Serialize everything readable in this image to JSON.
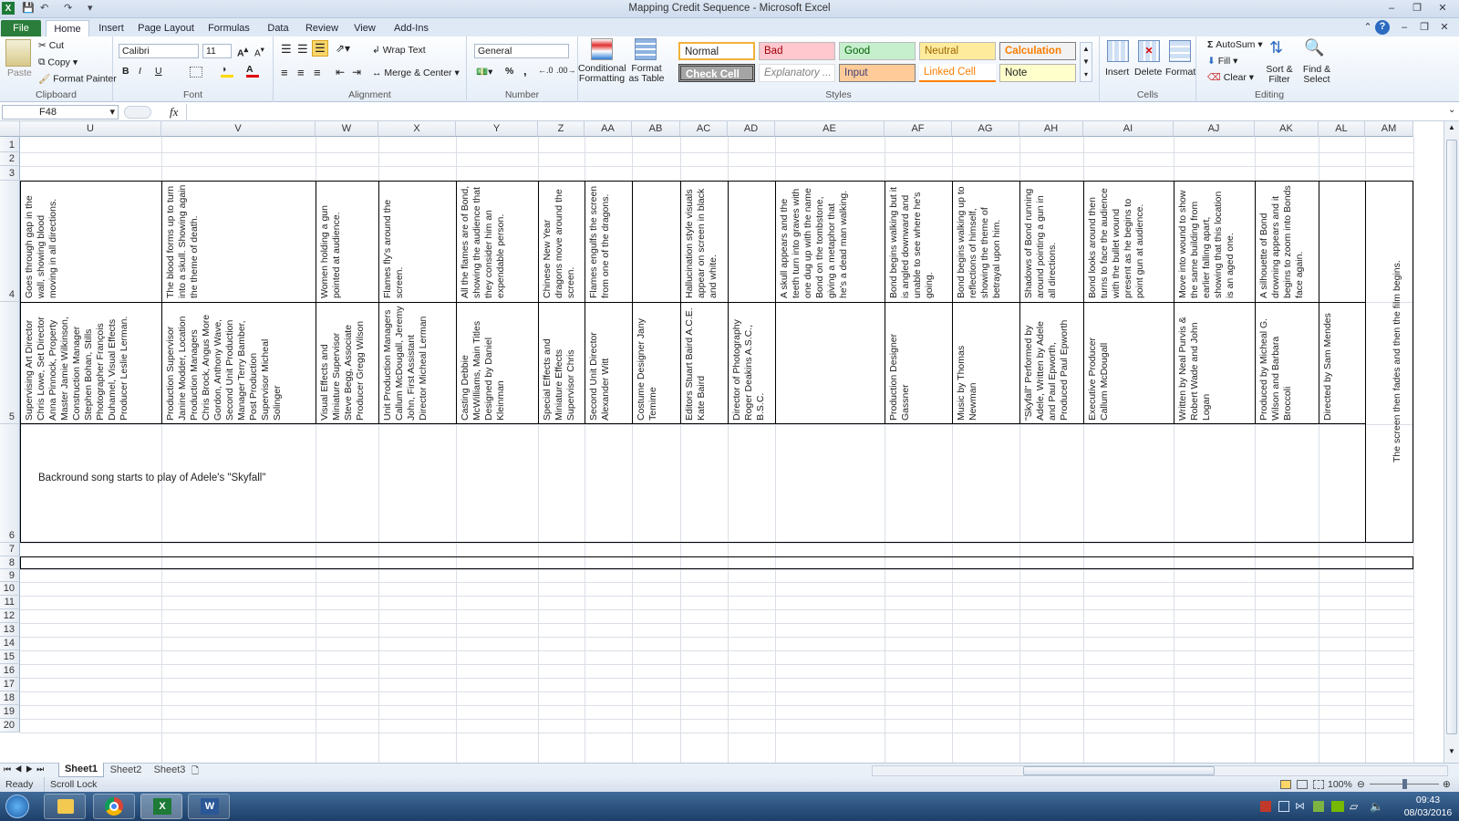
{
  "window": {
    "title": "Mapping Credit Sequence - Microsoft Excel"
  },
  "tabs": [
    "File",
    "Home",
    "Insert",
    "Page Layout",
    "Formulas",
    "Data",
    "Review",
    "View",
    "Add-Ins"
  ],
  "ribbon": {
    "clipboard": {
      "paste": "Paste",
      "cut": "Cut",
      "copy": "Copy",
      "format_painter": "Format Painter",
      "label": "Clipboard"
    },
    "font": {
      "name": "Calibri",
      "size": "11",
      "bold": "B",
      "italic": "I",
      "underline": "U",
      "label": "Font"
    },
    "alignment": {
      "wrap_text": "Wrap Text",
      "merge_center": "Merge & Center",
      "label": "Alignment"
    },
    "number": {
      "format": "General",
      "percent": "%",
      "comma": ",",
      "label": "Number"
    },
    "styles": {
      "conditional": "Conditional Formatting",
      "format_table": "Format as Table",
      "normal": "Normal",
      "bad": "Bad",
      "good": "Good",
      "neutral": "Neutral",
      "calculation": "Calculation",
      "check_cell": "Check Cell",
      "explanatory": "Explanatory ...",
      "input": "Input",
      "linked_cell": "Linked Cell",
      "note": "Note",
      "label": "Styles"
    },
    "cells": {
      "insert": "Insert",
      "delete": "Delete",
      "format": "Format",
      "label": "Cells"
    },
    "editing": {
      "autosum": "AutoSum",
      "fill": "Fill",
      "clear": "Clear",
      "sort_filter": "Sort & Filter",
      "find_select": "Find & Select",
      "label": "Editing"
    }
  },
  "formula_bar": {
    "name_box": "F48",
    "fx": "fx",
    "content": ""
  },
  "columns": [
    "U",
    "V",
    "W",
    "X",
    "Y",
    "Z",
    "AA",
    "AB",
    "AC",
    "AD",
    "AE",
    "AF",
    "AG",
    "AH",
    "AI",
    "AJ",
    "AK",
    "AL",
    "AM"
  ],
  "rows": [
    "1",
    "2",
    "3",
    "4",
    "5",
    "6",
    "7",
    "8",
    "9",
    "10",
    "11",
    "12",
    "13",
    "14",
    "15",
    "16",
    "17",
    "18",
    "19",
    "20"
  ],
  "row4": [
    "Goes through gap in the wall, showing blood moving in all directions.",
    "The blood forms up to turn into a skull. Showing again the theme of death.",
    "Women holding a gun pointed at audience.",
    "Flames fly's around the screen.",
    "All the flames are of Bond, showing the audience that they consider him an expendable person.",
    "Chinese New Year dragons move around the screen.",
    "Flames engulfs the screen from one of the dragons.",
    "",
    "Hallucination style visuals appear on screen in black and white.",
    "",
    "A skull appears and the teeth turn into graves with one dug up with the name Bond on the tombstone, giving a metaphor that he's a dead man walking.",
    "Bond begins walking but it is angled downward and unable to see where he's going.",
    "Bond begins walking up to reflections of himself, showing the theme of betrayal upon him.",
    "Shadows of Bond running around pointing a gun in all directions.",
    "Bond looks around then turns to face the audience with the bullet wound present as he begins to point gun at audience.",
    "Move into wound to show the same building from earlier falling apart, showing that this location is an aged one.",
    "A silhouette of Bond drowning appears and it begins to zoom into Bonds face again.",
    ""
  ],
  "row5": [
    "Supervising Art Director Chris Lowe, Set Director Anna Pinnock, Property Master Jamie Wilkinson, Construction Manager Stephen Bohan, Stills Photographer François Duhamel, Visual Effects Producer Leslie Lerman.",
    "Production Supervisor Janine Modder, Location Production Managers Chris Brock, Angus More Gordon, Anthony Wave, Second Unit Production Manager Terry Bamber, Post Production Supervisor Micheal Solinger",
    "Visual Effects and Miniature Supervisor Steve Begg, Associate Producer Gregg Wilson",
    "Unit Production Managers Callum McDougall, Jeremy John, First Assistant Director Micheal Lerman",
    "Casting Debbie McWilliams, Main Titles Designed by Daniel Kleinman",
    "Special Effects and Miniature Effects Supervisor Chris",
    "Second Unit Director Alexander Witt",
    "Costume Designer Jany Temime",
    "Editors Stuart Baird A.C.E. Kate Baird",
    "Director of Photography Roger Deakins A.S.C., B.S.C.",
    "",
    "Production Designer Gassner",
    "Music by Thomas Newman",
    "\"Skyfall\" Performed by Adele, Written by Adele and Paul Epworth, Produced Paul Epworth",
    "Executive Producer Callum McDougall",
    "Written by Neal Purvis & Robert Wade and John Logan",
    "Produced by Micheal G. Wilson and Barbara Broccoli",
    "Directed by Sam Mendes"
  ],
  "row6_text": "Backround song starts to play of Adele's \"Skyfall\"",
  "am_text": "The screen then fades and then the film begins.",
  "sheets": [
    "Sheet1",
    "Sheet2",
    "Sheet3"
  ],
  "status": {
    "ready": "Ready",
    "scroll_lock": "Scroll Lock",
    "zoom": "100%"
  },
  "taskbar": {
    "time": "09:43",
    "date": "08/03/2016"
  }
}
